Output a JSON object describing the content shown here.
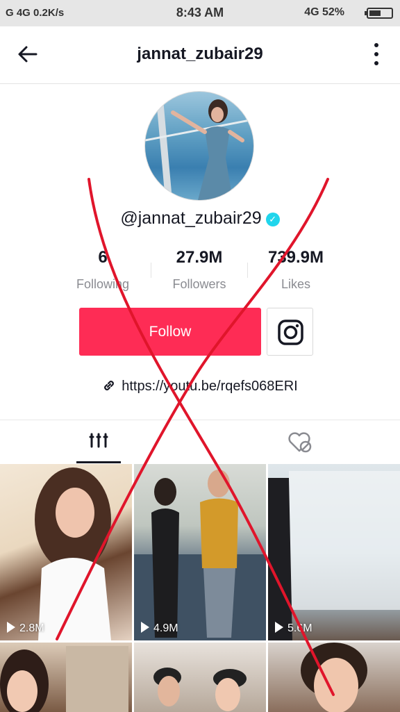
{
  "status_bar": {
    "left": "G 4G 0.2K/s",
    "time": "8:43 AM",
    "right": "4G 52%"
  },
  "header": {
    "title": "jannat_zubair29"
  },
  "profile": {
    "handle": "@jannat_zubair29",
    "stats": [
      {
        "value": "6",
        "label": "Following"
      },
      {
        "value": "27.9M",
        "label": "Followers"
      },
      {
        "value": "739.9M",
        "label": "Likes"
      }
    ],
    "follow_label": "Follow",
    "link": "https://youtu.be/rqefs068ERI"
  },
  "videos": [
    {
      "views": "2.8M"
    },
    {
      "views": "4.9M"
    },
    {
      "views": "5.6M"
    }
  ],
  "colors": {
    "accent": "#fe2c55",
    "verified": "#20d5ec",
    "cross_mark": "#e0152b"
  },
  "icons": [
    "back-arrow-icon",
    "more-vertical-icon",
    "verified-badge-icon",
    "instagram-icon",
    "link-icon",
    "grid-icon",
    "liked-heart-icon",
    "play-icon"
  ]
}
